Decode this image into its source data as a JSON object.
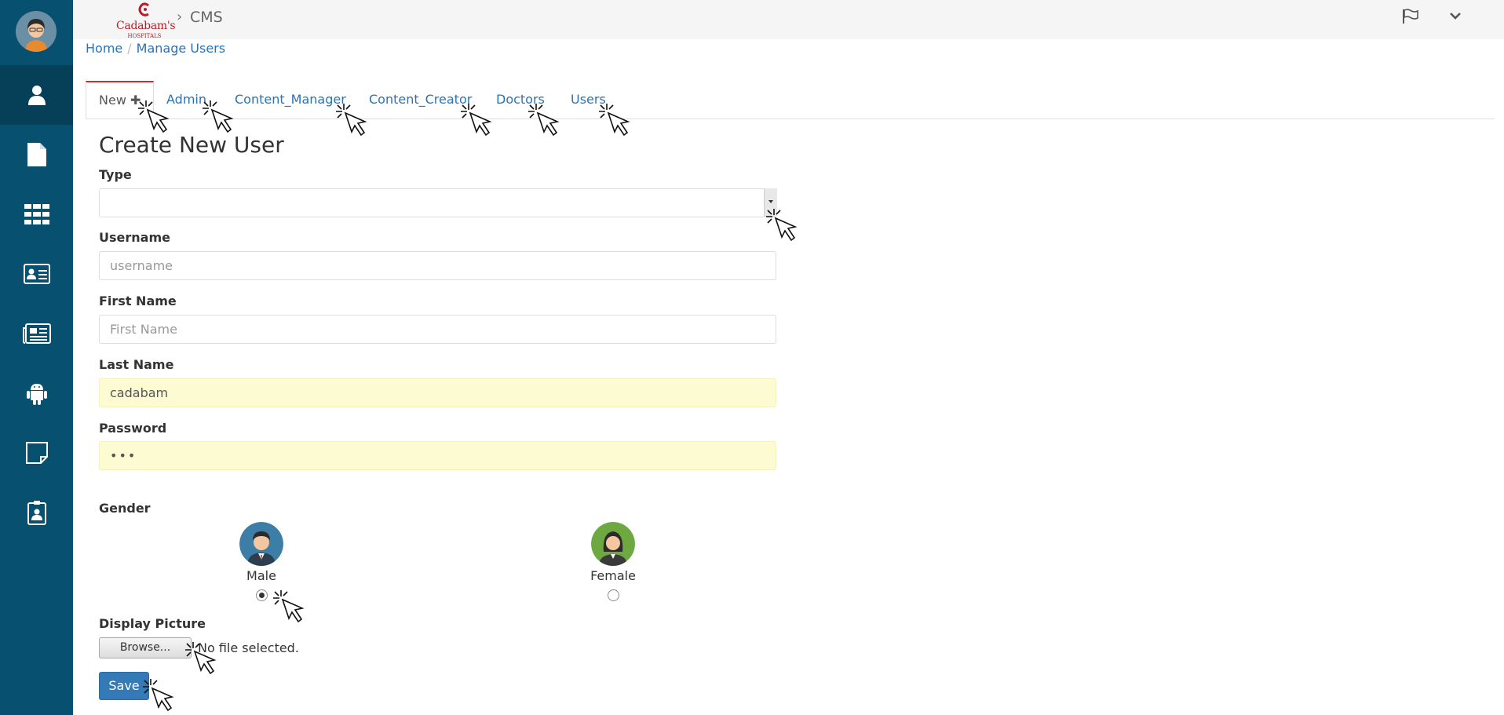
{
  "topbar": {
    "brand_word": "Cadabam's",
    "brand_sub": "HOSPITALS",
    "crumb_sep": "›",
    "section": "CMS"
  },
  "breadcrumb": {
    "home": "Home",
    "sep": "/",
    "current": "Manage Users"
  },
  "tabs": [
    {
      "label": "New ✚"
    },
    {
      "label": "Admin"
    },
    {
      "label": "Content_Manager"
    },
    {
      "label": "Content_Creator"
    },
    {
      "label": "Doctors"
    },
    {
      "label": "Users"
    }
  ],
  "form": {
    "title": "Create New User",
    "type_label": "Type",
    "type_value": "",
    "username_label": "Username",
    "username_placeholder": "username",
    "firstname_label": "First Name",
    "firstname_placeholder": "First Name",
    "lastname_label": "Last Name",
    "lastname_value": "cadabam",
    "password_label": "Password",
    "password_value": "•••",
    "gender_label": "Gender",
    "gender_male": "Male",
    "gender_female": "Female",
    "gender_selected": "Male",
    "display_picture_label": "Display Picture",
    "browse_label": "Browse...",
    "no_file_text": "No file selected.",
    "save_label": "Save"
  },
  "colors": {
    "sidebar": "#08506f",
    "sidebar_active": "#053f58",
    "link": "#2a73b5",
    "autofill": "#fdfbd2",
    "save": "#337ab7"
  }
}
